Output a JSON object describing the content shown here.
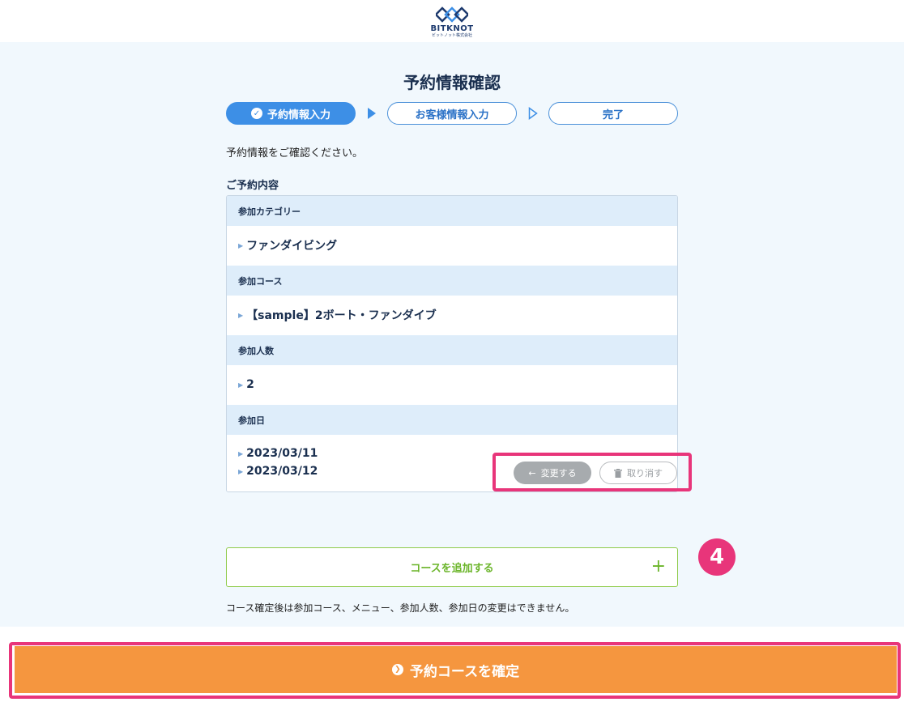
{
  "header": {
    "logo_text": "BITKNOT",
    "logo_sub": "ビットノット株式会社"
  },
  "page": {
    "title": "予約情報確認"
  },
  "steps": [
    {
      "label": "予約情報入力",
      "active": true
    },
    {
      "label": "お客様情報入力",
      "active": false
    },
    {
      "label": "完了",
      "active": false
    }
  ],
  "intro_text": "予約情報をご確認ください。",
  "section_title": "ご予約内容",
  "details": {
    "category_label": "参加カテゴリー",
    "category_value": "ファンダイビング",
    "course_label": "参加コース",
    "course_value": "【sample】2ボート・ファンダイブ",
    "people_label": "参加人数",
    "people_value": "2",
    "date_label": "参加日",
    "dates": [
      "2023/03/11",
      "2023/03/12"
    ]
  },
  "actions": {
    "change_label": "変更する",
    "cancel_label": "取り消す"
  },
  "add_course_label": "コースを追加する",
  "add_course_plus": "+",
  "notice_text": "コース確定後は参加コース、メニュー、参加人数、参加日の変更はできません。",
  "badge_number": "4",
  "confirm_label": "予約コースを確定",
  "colors": {
    "accent_blue": "#3d8fe6",
    "confirm_orange": "#f5963f",
    "highlight_pink": "#e8357a",
    "add_green": "#6bb52a"
  }
}
